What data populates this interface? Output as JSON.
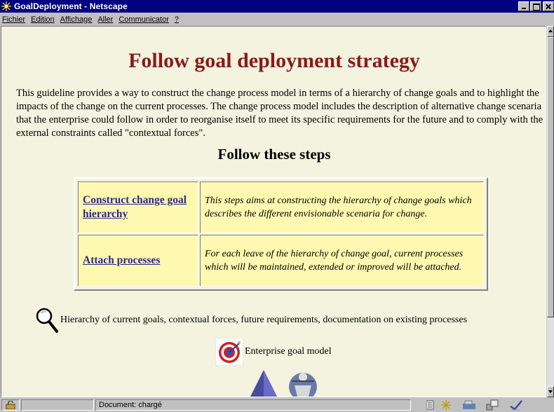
{
  "window": {
    "title": "GoalDeployment - Netscape"
  },
  "menu": {
    "items": [
      "Fichier",
      "Edition",
      "Affichage",
      "Aller",
      "Communicator",
      "?"
    ]
  },
  "page": {
    "title": "Follow goal deployment strategy",
    "intro": "This guideline provides a way to construct the change process model in terms of a hierarchy of change goals and to highlight the impacts of the change on the current processes. The change process model includes the description of alternative change scenaria that the enterprise could follow in order to reorganise itself to meet its specific requirements for the future and to comply with the external constraints called \"contextual forces\".",
    "steps_heading": "Follow these steps",
    "steps": [
      {
        "link": "Construct change goal hierarchy",
        "description": "This steps aims at constructing the hierarchy of change goals which describes the different envisionable scenaria for change."
      },
      {
        "link": "Attach processes",
        "description": "For each leave of the hierarchy of change goal, current processes which will be maintained, extended or improved will be attached."
      }
    ],
    "resources_text": "Hierarchy of current goals, contextual forces, future requirements, documentation on existing processes",
    "product_text": "Enterprise goal model"
  },
  "status": {
    "text": "Document: chargé"
  },
  "colors": {
    "title_bar": "#000080",
    "page_background": "#f3f3df",
    "heading": "#8b1a1a",
    "table_cell": "#fff8b0",
    "link": "#2a2a8c"
  },
  "icons": [
    "netscape-logo-icon",
    "minimize-icon",
    "maximize-icon",
    "close-icon",
    "magnifier-icon",
    "target-icon",
    "triangle-icon",
    "figure-icon",
    "lock-icon",
    "component-bar-icons"
  ]
}
